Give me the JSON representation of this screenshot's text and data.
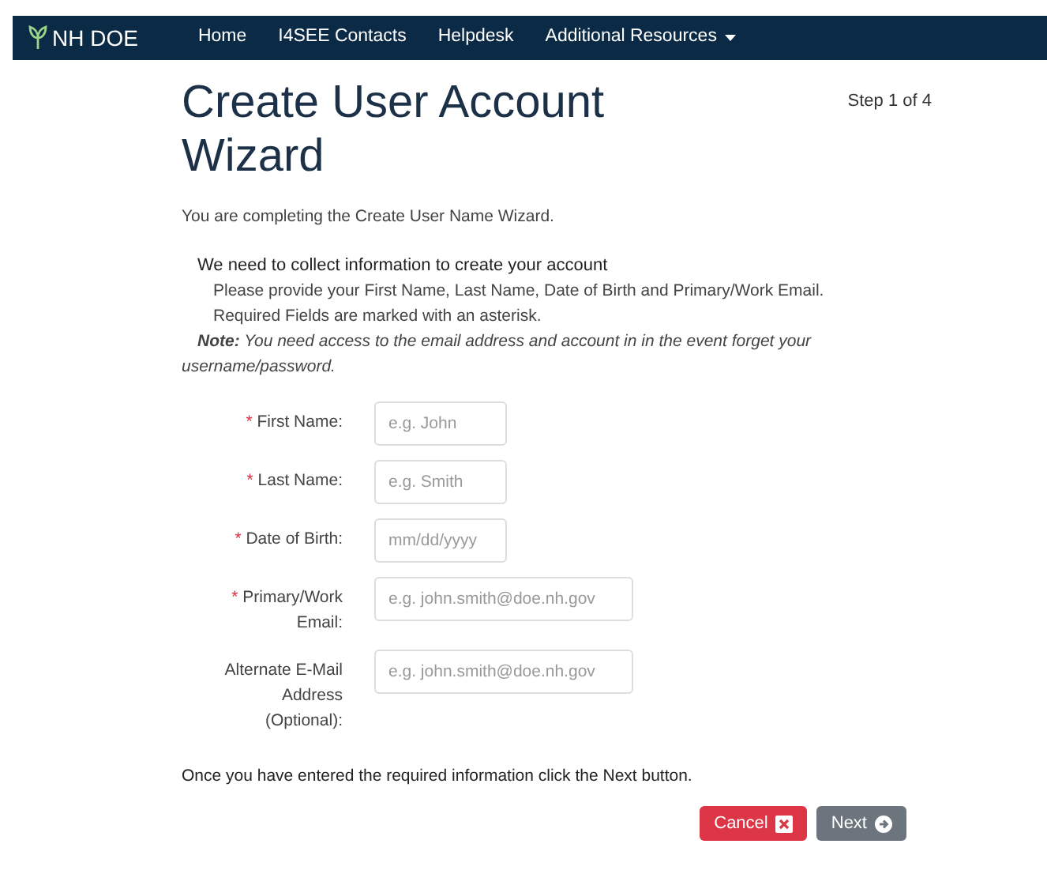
{
  "navbar": {
    "brand": "NH DOE",
    "links": [
      {
        "label": "Home",
        "dropdown": false
      },
      {
        "label": "I4SEE Contacts",
        "dropdown": false
      },
      {
        "label": "Helpdesk",
        "dropdown": false
      },
      {
        "label": "Additional Resources",
        "dropdown": true
      }
    ]
  },
  "title": "Create User Account Wizard",
  "step": "Step 1 of 4",
  "intro": "You are completing the Create User Name Wizard.",
  "section_heading": "We need to collect information to create your account",
  "instructions": [
    "Please provide your First Name, Last Name, Date of Birth and Primary/Work Email.",
    "Required Fields are marked with an asterisk."
  ],
  "note": "**Note:** You need access to the email address and account in in the event forget your username/password.",
  "required_marker": "*",
  "fields": [
    {
      "label": "First Name:",
      "required": true,
      "placeholder": "e.g. John",
      "kind": "text"
    },
    {
      "label": "Last Name:",
      "required": true,
      "placeholder": "e.g. Smith",
      "kind": "text"
    },
    {
      "label": "Date of Birth:",
      "required": true,
      "placeholder": "mm/dd/yyyy",
      "kind": "date"
    },
    {
      "label": "Primary/Work Email:",
      "required": true,
      "placeholder": "e.g. john.smith@doe.nh.gov",
      "kind": "email"
    },
    {
      "label": "Alternate E-Mail Address (Optional):",
      "required": false,
      "placeholder": "e.g. john.smith@doe.nh.gov",
      "kind": "email"
    }
  ],
  "footer_text": "Once you have entered the required information click the Next button.",
  "buttons": [
    {
      "label": "Cancel",
      "kind": "cancel"
    },
    {
      "label": "Next",
      "kind": "next"
    }
  ]
}
